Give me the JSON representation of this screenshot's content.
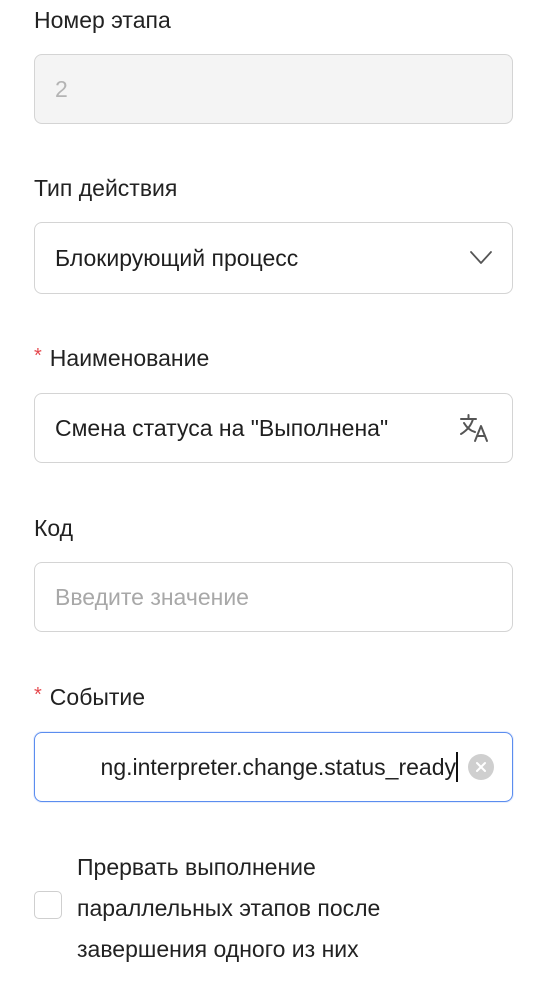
{
  "stage_number": {
    "label": "Номер этапа",
    "value": "2"
  },
  "action_type": {
    "label": "Тип действия",
    "value": "Блокирующий процесс"
  },
  "name": {
    "required_mark": "*",
    "label": "Наименование",
    "value": "Смена статуса на \"Выполнена\""
  },
  "code": {
    "label": "Код",
    "placeholder": "Введите значение"
  },
  "event": {
    "required_mark": "*",
    "label": "Событие",
    "visible_value": "ng.interpreter.change.status_ready"
  },
  "interrupt_checkbox": {
    "checked": false,
    "label": "Прервать выполнение параллельных этапов после завершения одного из них"
  },
  "colors": {
    "required": "#e5484d",
    "focus_border": "#5b8def",
    "border": "#d4d4d4",
    "disabled_bg": "#f4f4f4"
  },
  "icons": {
    "select": "chevron-down-icon",
    "translate": "translate-icon",
    "clear": "clear-icon"
  }
}
